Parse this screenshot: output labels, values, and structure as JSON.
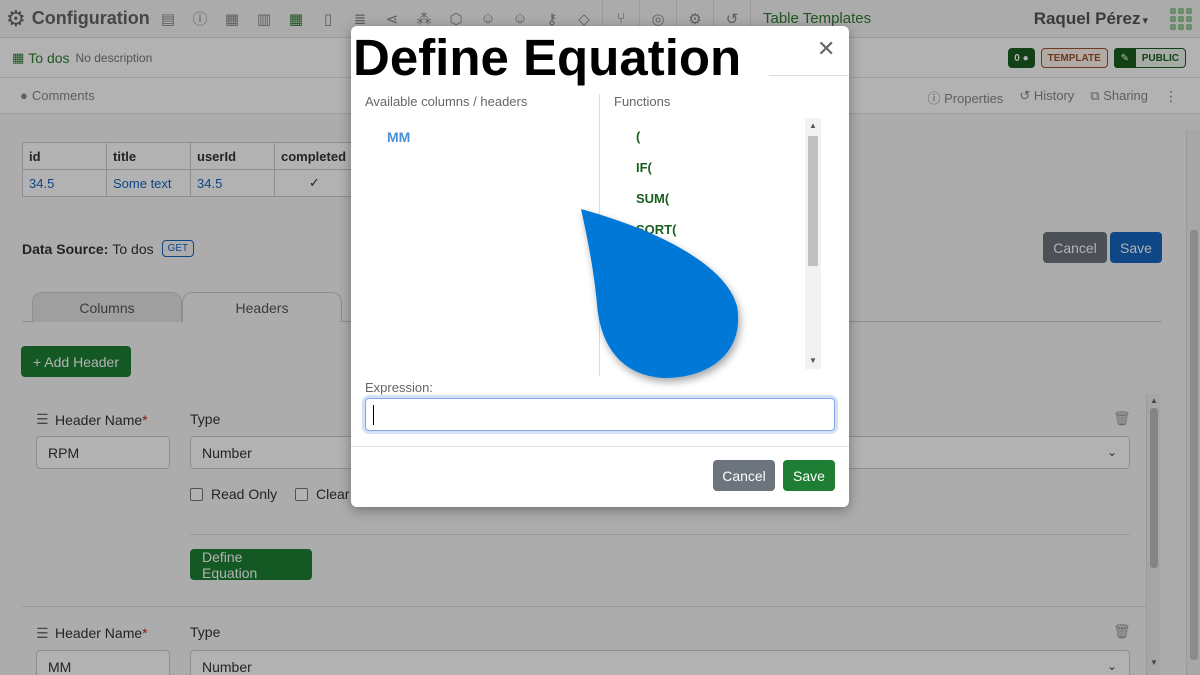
{
  "topbar": {
    "app_title": "Configuration",
    "link": "Table Templates",
    "user": "Raquel Pérez",
    "icons": [
      "gear-icon",
      "form-icon",
      "info-icon",
      "table-icon",
      "list-icon",
      "table-grid-icon",
      "file-icon",
      "database-icon",
      "share-icon",
      "network-icon",
      "hexagon-icon",
      "user-group-icon",
      "user-icon",
      "key-icon",
      "cube-icon",
      "branch-icon",
      "location-icon",
      "settings-cog-icon",
      "history-icon"
    ]
  },
  "docbar": {
    "name": "To dos",
    "description": "No description",
    "comment_count": "0",
    "template_label": "TEMPLATE",
    "public_label": "PUBLIC"
  },
  "actbar": {
    "comments": "Comments",
    "properties": "Properties",
    "history": "History",
    "sharing": "Sharing"
  },
  "preview_table": {
    "headers": [
      "id",
      "title",
      "userId",
      "completed"
    ],
    "row": [
      "34.5",
      "Some text",
      "34.5",
      "✓"
    ]
  },
  "datasource": {
    "label": "Data Source:",
    "value": "To dos",
    "method": "GET"
  },
  "buttons": {
    "cancel": "Cancel",
    "save": "Save",
    "add_header": "+ Add Header",
    "define_equation": "Define Equation"
  },
  "tabs": [
    "Columns",
    "Headers"
  ],
  "headers_form": {
    "header_name_label": "Header Name",
    "required_mark": "*",
    "type_label": "Type",
    "items": [
      {
        "name": "RPM",
        "type": "Number"
      },
      {
        "name": "MM",
        "type": "Number"
      }
    ],
    "read_only": "Read Only",
    "clear": "Clear"
  },
  "modal": {
    "title": "Define Equation",
    "available_label": "Available columns / headers",
    "functions_label": "Functions",
    "available": [
      "MM"
    ],
    "functions": [
      "(",
      "IF(",
      "SUM(",
      "SQRT("
    ],
    "expression_label": "Expression:",
    "expression_value": "",
    "cancel": "Cancel",
    "save": "Save"
  },
  "colors": {
    "accent_green": "#1e7e34",
    "primary_blue": "#1565c0",
    "drop_blue": "#0078d7"
  }
}
